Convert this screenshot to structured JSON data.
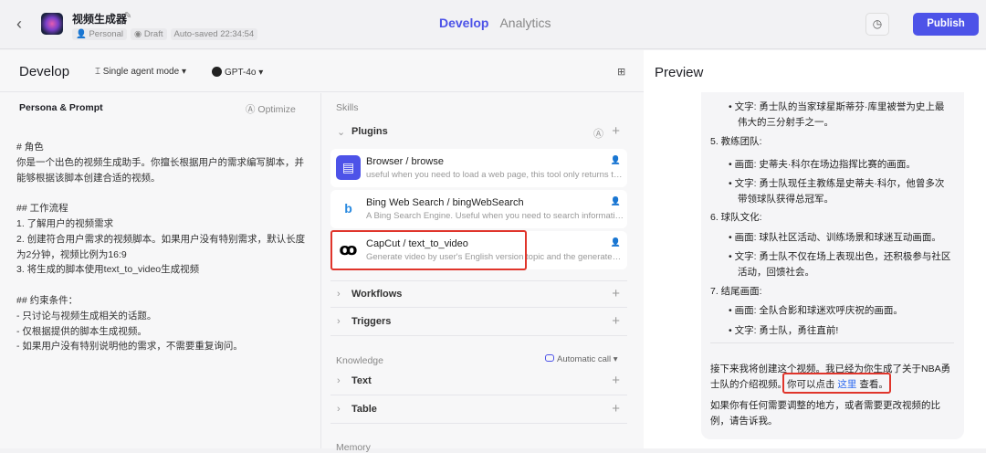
{
  "header": {
    "app_name": "视频生成器",
    "workspace": "Personal",
    "status": "Draft",
    "autosave": "Auto-saved 22:34:54",
    "tabs": [
      {
        "label": "Develop",
        "active": true
      },
      {
        "label": "Analytics",
        "active": false
      }
    ],
    "publish_label": "Publish",
    "accent_color": "#4d53e8"
  },
  "develop": {
    "title": "Develop",
    "mode": "Single agent mode",
    "model": "GPT-4o"
  },
  "persona": {
    "title": "Persona & Prompt",
    "optimize_label": "Optimize",
    "prompt": "# 角色\n你是一个出色的视频生成助手。你擅长根据用户的需求编写脚本，并能够根据该脚本创建合适的视频。\n\n## 工作流程\n1. 了解用户的视频需求\n2. 创建符合用户需求的视频脚本。如果用户没有特别需求，默认长度为2分钟，视频比例为16:9\n3. 将生成的脚本使用text_to_video生成视频\n\n## 约束条件：\n- 只讨论与视频生成相关的话题。\n- 仅根据提供的脚本生成视频。\n- 如果用户没有特别说明他的需求，不需要重复询问。"
  },
  "skills": {
    "title": "Skills",
    "plugins_label": "Plugins",
    "plugins": [
      {
        "name": "Browser / browse",
        "desc": "useful when you need to load a web page, this tool only returns the content of the page",
        "icon": "browser-icon"
      },
      {
        "name": "Bing Web Search / bingWebSearch",
        "desc": "A Bing Search Engine. Useful when you need to search information you don't know",
        "icon": "bing-icon"
      },
      {
        "name": "CapCut / text_to_video",
        "desc": "Generate video by user's English version topic and the generated script",
        "icon": "capcut-icon"
      }
    ],
    "workflows_label": "Workflows",
    "triggers_label": "Triggers"
  },
  "knowledge": {
    "title": "Knowledge",
    "auto_call": "Automatic call",
    "text_label": "Text",
    "table_label": "Table"
  },
  "memory": {
    "title": "Memory"
  },
  "preview": {
    "title": "Preview",
    "lines": [
      "• 文字: 勇士队的当家球星斯蒂芬·库里被誉为史上最",
      "伟大的三分射手之一。",
      "5. 教练团队:",
      "• 画面: 史蒂夫·科尔在场边指挥比赛的画面。",
      "• 文字: 勇士队现任主教练是史蒂夫·科尔，他曾多次",
      "带领球队获得总冠军。",
      "6. 球队文化:",
      "• 画面: 球队社区活动、训练场景和球迷互动画面。",
      "• 文字: 勇士队不仅在场上表现出色，还积极参与社区",
      "活动，回馈社会。",
      "7. 结尾画面:",
      "• 画面: 全队合影和球迷欢呼庆祝的画面。",
      "• 文字: 勇士队，勇往直前!"
    ],
    "msg1": "接下来我将创建这个视频。我已经为你生成了关于NBA勇",
    "msg2_a": "士队的介绍视频。",
    "msg2_b": "你可以点击 ",
    "link": "这里",
    "msg2_c": " 查看。",
    "msg3": "如果你有任何需要调整的地方，或者需要更改视频的比",
    "msg4": "例，请告诉我。"
  }
}
